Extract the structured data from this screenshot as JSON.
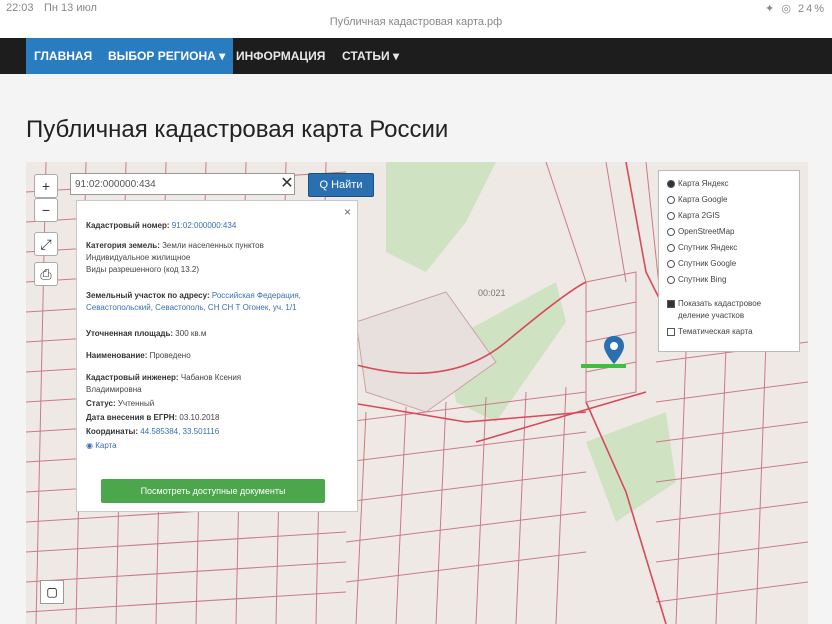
{
  "status_bar": {
    "time": "22:03",
    "date": "Пн 13 июл",
    "url": "Публичная кадастровая карта.рф",
    "system_icons": "✦ ◎ 24%"
  },
  "nav": {
    "items": [
      "ГЛАВНАЯ",
      "ВЫБОР РЕГИОНА",
      "ИНФОРМАЦИЯ",
      "СТАТЬИ"
    ],
    "dropdown_marker": "▾"
  },
  "page": {
    "title": "Публичная кадастровая карта России"
  },
  "map": {
    "zoom_in": "+",
    "zoom_out": "−",
    "ruler_icon": "⤢",
    "print_icon": "⎙",
    "search": {
      "value": "91:02:000000:434",
      "clear": "✕",
      "button": "Q Найти"
    },
    "area_label": "00:021",
    "corner_icon": "▢"
  },
  "info": {
    "close": "×",
    "cadastral_label": "Кадастровый номер:",
    "cadastral_value": "91:02:000000:434",
    "category_label": "Категория земель:",
    "category_value": "Земли населенных пунктов",
    "category_value2": "Индивидуальное жилищное",
    "usage_value": "Виды разрешенного (код 13.2)",
    "address_label": "Земельный участок по адресу:",
    "address_value": "Российская Федерация,",
    "address_value2": "Севастопольский, Севастополь, СН СН Т Огонек, уч. 1/1",
    "area_label": "Уточненная площадь:",
    "area_value": "300 кв.м",
    "owner_label": "Наименование:",
    "owner_value": "Проведено",
    "engineer_label": "Кадастровый инженер:",
    "engineer_value": "Чабанов Ксения",
    "engineer_value2": "Владимировна",
    "status_label": "Статус:",
    "status_value": "Учтенный",
    "date_label": "Дата внесения в ЕГРН:",
    "date_value": "03.10.2018",
    "coords_label": "Координаты:",
    "coords_value": "44.585384, 33.501116",
    "map_link": "Карта",
    "button": "Посмотреть доступные документы"
  },
  "layers": {
    "options": [
      "Карта Яндекс",
      "Карта Google",
      "Карта 2GIS",
      "OpenStreetMap",
      "Спутник Яндекс",
      "Спутник Google",
      "Спутник Bing"
    ],
    "selected_index": 0,
    "show_cadastral": "Показать кадастровое",
    "show_cadastral2": "деление участков",
    "thematic": "Тематическая карта"
  }
}
